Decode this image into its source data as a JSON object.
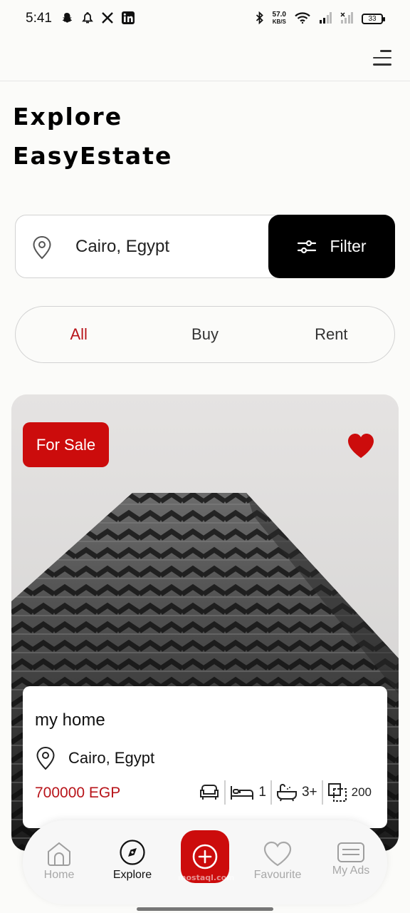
{
  "status_bar": {
    "time": "5:41",
    "left_icons": [
      "snapchat-icon",
      "notification-icon",
      "x-icon",
      "linkedin-icon"
    ],
    "net_speed_value": "57.0",
    "net_speed_unit": "KB/S",
    "battery": "33"
  },
  "header": {
    "menu_icon": "menu-icon"
  },
  "page": {
    "title_line1": "Explore",
    "title_line2": "EasyEstate"
  },
  "search": {
    "location": "Cairo, Egypt",
    "filter_label": "Filter"
  },
  "tabs": [
    {
      "label": "All",
      "active": true
    },
    {
      "label": "Buy",
      "active": false
    },
    {
      "label": "Rent",
      "active": false
    }
  ],
  "listing": {
    "badge": "For Sale",
    "name": "my home",
    "location": "Cairo, Egypt",
    "price": "700000 EGP",
    "bedrooms": "1",
    "bathrooms": "3+",
    "area": "200",
    "favorite": true
  },
  "bottom_nav": {
    "items": [
      {
        "label": "Home",
        "active": false
      },
      {
        "label": "Explore",
        "active": true
      },
      {
        "label": "Favourite",
        "active": false
      },
      {
        "label": "My Ads",
        "active": false
      }
    ],
    "watermark": "mostaql.com"
  },
  "colors": {
    "accent": "#cc0c0c",
    "price": "#b8141a",
    "filter_bg": "#000000"
  }
}
